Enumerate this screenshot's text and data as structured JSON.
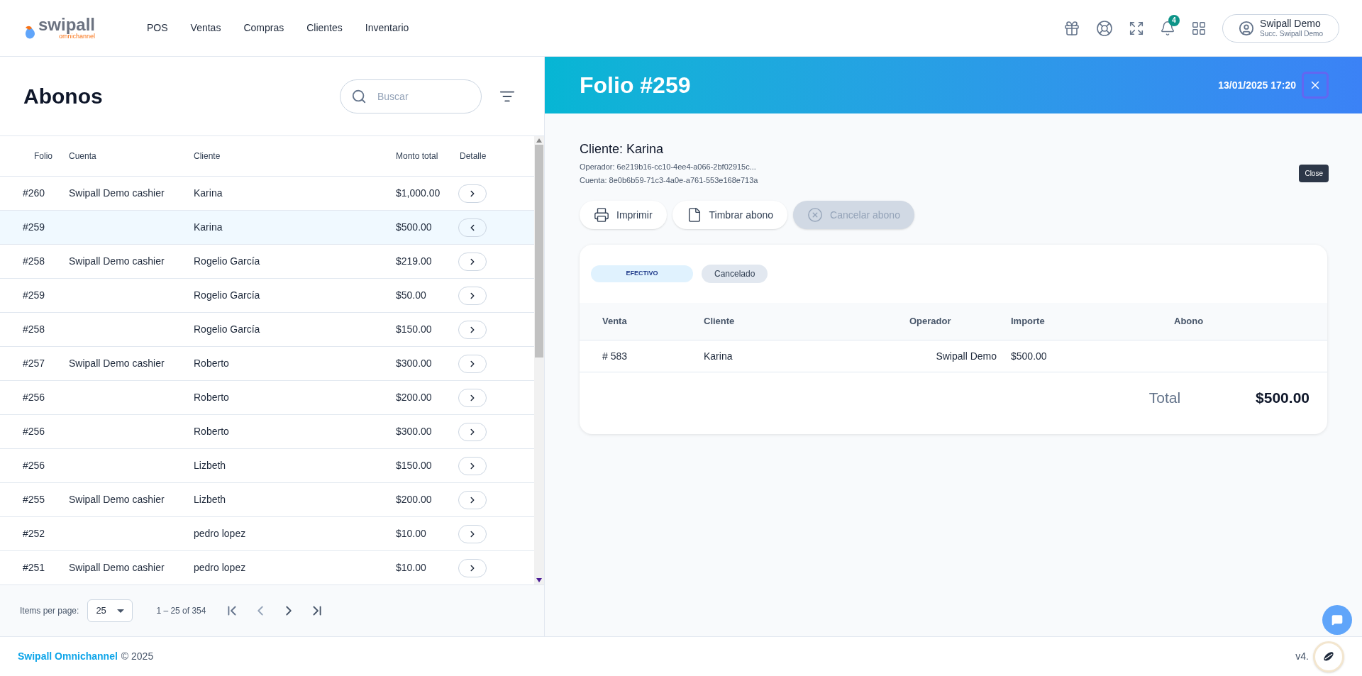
{
  "nav": {
    "logo": "swipall",
    "logo_sub": "omnichannel",
    "items": [
      "POS",
      "Ventas",
      "Compras",
      "Clientes",
      "Inventario"
    ],
    "notifications": "4",
    "user": {
      "name": "Swipall Demo",
      "branch": "Succ. Swipall Demo"
    }
  },
  "list": {
    "title": "Abonos",
    "search": {
      "placeholder": "Buscar"
    },
    "columns": [
      "Folio",
      "Cuenta",
      "Cliente",
      "Monto total",
      "Detalle"
    ],
    "rows": [
      {
        "folio": "#260",
        "cuenta": "Swipall Demo cashier",
        "cliente": "Karina",
        "monto": "$1,000.00",
        "selected": false
      },
      {
        "folio": "#259",
        "cuenta": "",
        "cliente": "Karina",
        "monto": "$500.00",
        "selected": true
      },
      {
        "folio": "#258",
        "cuenta": "Swipall Demo cashier",
        "cliente": "Rogelio García",
        "monto": "$219.00",
        "selected": false
      },
      {
        "folio": "#259",
        "cuenta": "",
        "cliente": "Rogelio García",
        "monto": "$50.00",
        "selected": false
      },
      {
        "folio": "#258",
        "cuenta": "",
        "cliente": "Rogelio García",
        "monto": "$150.00",
        "selected": false
      },
      {
        "folio": "#257",
        "cuenta": "Swipall Demo cashier",
        "cliente": "Roberto",
        "monto": "$300.00",
        "selected": false
      },
      {
        "folio": "#256",
        "cuenta": "",
        "cliente": "Roberto",
        "monto": "$200.00",
        "selected": false
      },
      {
        "folio": "#256",
        "cuenta": "",
        "cliente": "Roberto",
        "monto": "$300.00",
        "selected": false
      },
      {
        "folio": "#256",
        "cuenta": "",
        "cliente": "Lizbeth",
        "monto": "$150.00",
        "selected": false
      },
      {
        "folio": "#255",
        "cuenta": "Swipall Demo cashier",
        "cliente": "Lizbeth",
        "monto": "$200.00",
        "selected": false
      },
      {
        "folio": "#252",
        "cuenta": "",
        "cliente": "pedro lopez",
        "monto": "$10.00",
        "selected": false
      },
      {
        "folio": "#251",
        "cuenta": "Swipall Demo cashier",
        "cliente": "pedro lopez",
        "monto": "$10.00",
        "selected": false
      }
    ],
    "pagination": {
      "label": "Items per page:",
      "size": "25",
      "range": "1 – 25 of 354"
    }
  },
  "detail": {
    "title": "Folio #259",
    "date": "13/01/2025 17:20",
    "close_tooltip": "Close",
    "cliente": "Cliente: Karina",
    "operador": "Operador: 6e219b16-cc10-4ee4-a066-2bf02915c...",
    "cuenta": "Cuenta: 8e0b6b59-71c3-4a0e-a761-553e168e713a",
    "actions": [
      {
        "kind": "print",
        "label": "Imprimir",
        "disabled": false
      },
      {
        "kind": "file",
        "label": "Timbrar abono",
        "disabled": false
      },
      {
        "kind": "cancel",
        "label": "Cancelar abono",
        "disabled": true
      }
    ],
    "tags": [
      {
        "label": "EFECTIVO",
        "kind": "method"
      },
      {
        "label": "Cancelado",
        "kind": "status"
      }
    ],
    "columns": [
      "Venta",
      "Cliente",
      "Operador",
      "Importe",
      "Abono"
    ],
    "rows": [
      {
        "venta": "# 583",
        "cliente": "Karina",
        "operador": "Swipall Demo",
        "importe": "$500.00"
      }
    ],
    "total_label": "Total",
    "total": "$500.00"
  },
  "footer": {
    "brand": "Swipall Omnichannel",
    "copyright": "© 2025",
    "version": "v4."
  }
}
